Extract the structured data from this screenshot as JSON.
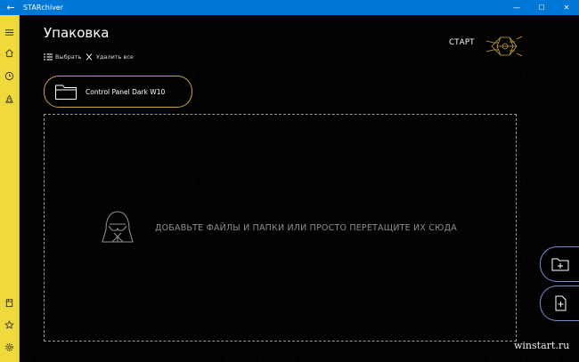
{
  "window": {
    "title": "STARchiver",
    "back_icon": "arrow-left-icon",
    "minimize_icon": "minimize-icon",
    "maximize_icon": "maximize-icon",
    "close_icon": "close-icon",
    "titlebar_color": "#0078d7"
  },
  "nav": {
    "color": "#f0d93a",
    "top_items": [
      "hamburger-icon",
      "home-icon",
      "history-icon",
      "recycle-icon"
    ],
    "bottom_items": [
      "archive-icon",
      "star-icon",
      "settings-icon"
    ]
  },
  "page": {
    "title": "Упаковка",
    "select_label": "Выбрать",
    "delete_all_label": "Удалить все",
    "start_label": "СТАРТ"
  },
  "files": [
    {
      "name": "Control Panel Dark W10",
      "icon": "folder-icon"
    }
  ],
  "dropzone": {
    "text": "ДОБАВЬТЕ ФАЙЛЫ И ПАПКИ ИЛИ ПРОСТО ПЕРЕТАЩИТЕ ИХ СЮДА",
    "icon": "darth-vader-icon"
  },
  "actions": {
    "add_folder_icon": "add-folder-icon",
    "add_file_icon": "add-file-icon",
    "accent": "#7b8fd6"
  },
  "watermark": "winstart.ru"
}
